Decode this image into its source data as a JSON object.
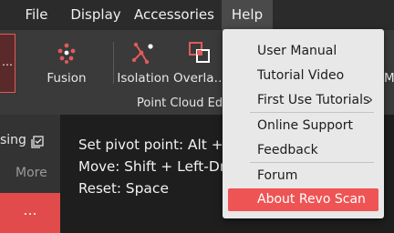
{
  "menubar": {
    "items": [
      {
        "label": "File"
      },
      {
        "label": "Display"
      },
      {
        "label": "Accessories"
      },
      {
        "label": "Help"
      }
    ]
  },
  "toolbar": {
    "left_strip_label": "…",
    "tools": [
      {
        "label": "Fusion",
        "icon": "fusion-icon"
      },
      {
        "label": "Isolation",
        "icon": "isolation-icon"
      },
      {
        "label": "Overla…",
        "icon": "overlap-icon"
      }
    ],
    "group_label": "Point Cloud Ed",
    "clipped_label": "M"
  },
  "left_panel": {
    "item_label": "sing",
    "more_label": "More",
    "button_label": "…"
  },
  "hints": [
    {
      "label": "Set pivot point:",
      "keys": "Alt + L"
    },
    {
      "label": "Move:",
      "keys": "Shift + Left-Dra"
    },
    {
      "label": "Reset:",
      "keys": "Space"
    }
  ],
  "help_menu": {
    "items": [
      {
        "label": "User Manual"
      },
      {
        "label": "Tutorial Video"
      },
      {
        "label": "First Use Tutorials",
        "submenu_arrow": "›"
      },
      {
        "label": "Online Support"
      },
      {
        "label": "Feedback"
      },
      {
        "label": "Forum"
      },
      {
        "label": "About Revo Scan",
        "highlighted": true
      }
    ]
  },
  "colors": {
    "accent": "#ee5454",
    "menubar_bg": "#2b2b2b",
    "toolbar_bg": "#3a3a3a",
    "dropdown_bg": "#e8e8e8"
  }
}
